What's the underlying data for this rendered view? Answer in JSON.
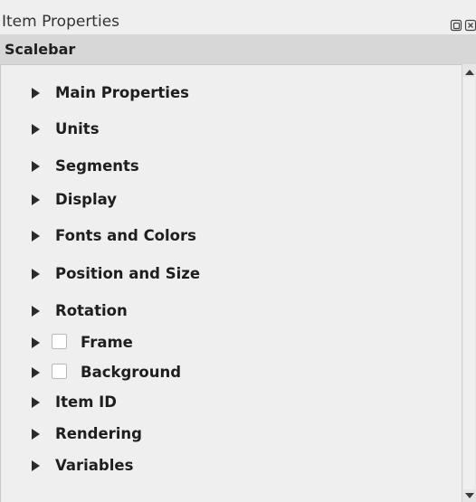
{
  "window": {
    "title": "Item Properties",
    "float_icon": "float-icon",
    "close_icon": "close-icon"
  },
  "section": {
    "title": "Scalebar"
  },
  "groups": [
    {
      "label": "Main Properties",
      "checkable": false
    },
    {
      "label": "Units",
      "checkable": false
    },
    {
      "label": "Segments",
      "checkable": false
    },
    {
      "label": "Display",
      "checkable": false
    },
    {
      "label": "Fonts and Colors",
      "checkable": false
    },
    {
      "label": "Position and Size",
      "checkable": false
    },
    {
      "label": "Rotation",
      "checkable": false
    },
    {
      "label": "Frame",
      "checkable": true,
      "checked": false
    },
    {
      "label": "Background",
      "checkable": true,
      "checked": false
    },
    {
      "label": "Item ID",
      "checkable": false
    },
    {
      "label": "Rendering",
      "checkable": false
    },
    {
      "label": "Variables",
      "checkable": false
    }
  ],
  "scrollbar": {
    "up_icon": "scroll-up-arrow-icon",
    "down_icon": "scroll-down-arrow-icon"
  }
}
